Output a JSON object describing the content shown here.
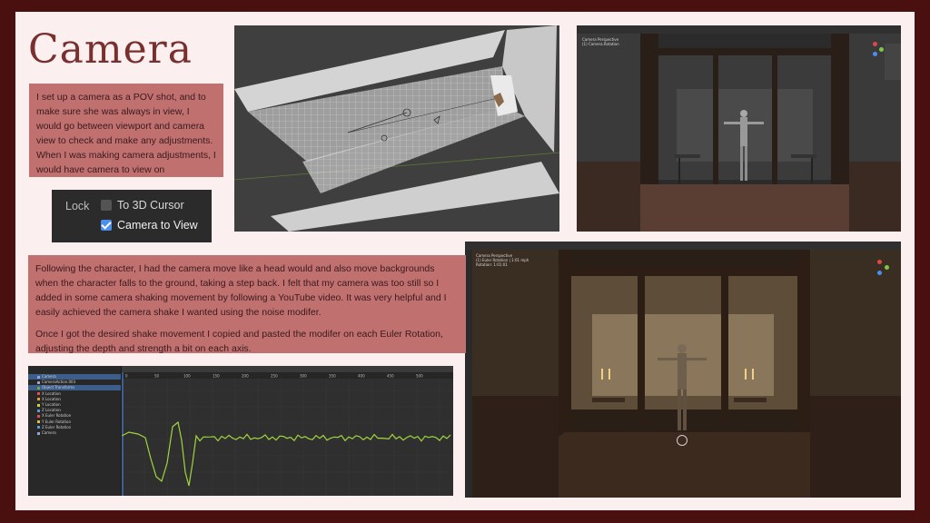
{
  "title": "Camera",
  "paragraph_1": "I set up a camera as a POV shot, and to make sure she was always in view, I would go between viewport and camera view to check and make any adjustments. When I was making camera adjustments, I would have camera to view on",
  "lock_panel": {
    "label": "Lock",
    "options": [
      {
        "label": "To 3D Cursor",
        "checked": false
      },
      {
        "label": "Camera to View",
        "checked": true
      }
    ]
  },
  "paragraph_2a": "Following the character, I had the camera move like a head would and also move backgrounds when the character falls to the ground, taking a step back. I felt that my camera was too still so I added in some camera shaking movement by following a YouTube video. It was very helpful and I easily achieved the camera shake I wanted using the noise modifer.",
  "paragraph_2b": "Once I got the desired shake movement I copied and pasted the modifer on each Euler Rotation, adjusting the depth and strength a bit on each axis.",
  "screenshots": {
    "viewport_top": {
      "name": "Top-down viewport of room with camera"
    },
    "camera_view_1": {
      "name": "Camera view of room with figure",
      "overlay": [
        "Camera Perspective",
        "(1) Camera.Rotation"
      ]
    },
    "camera_view_2": {
      "name": "Rendered camera view of room",
      "overlay": [
        "Camera Perspective",
        "(1) Euler Rotation | 1:01 mph",
        "Rotation: 1:01:01"
      ]
    },
    "graph_editor": {
      "name": "Graph editor with noise modifier curves",
      "ruler_ticks": [
        "0",
        "50",
        "100",
        "150",
        "200",
        "250",
        "300",
        "350",
        "400",
        "450",
        "500"
      ],
      "outliner": [
        {
          "label": "Camera",
          "color": "#8fa8d8",
          "selected": true
        },
        {
          "label": "CameraAction.003",
          "color": "#8fa8d8",
          "selected": false
        },
        {
          "label": "Object Transforms",
          "color": "#6aa84f",
          "selected": true
        },
        {
          "label": "X Location",
          "color": "#e05050",
          "selected": false
        },
        {
          "label": "X Location",
          "color": "#e0a030",
          "selected": false
        },
        {
          "label": "Y Location",
          "color": "#d0d040",
          "selected": false
        },
        {
          "label": "Z Location",
          "color": "#50a0e0",
          "selected": false
        },
        {
          "label": "X Euler Rotation",
          "color": "#e05050",
          "selected": false
        },
        {
          "label": "Y Euler Rotation",
          "color": "#e0c030",
          "selected": false
        },
        {
          "label": "Z Euler Rotation",
          "color": "#50a0e0",
          "selected": false
        },
        {
          "label": "Camera",
          "color": "#8fa8d8",
          "selected": false
        }
      ]
    }
  },
  "colors": {
    "frame": "#4a0f0f",
    "page": "#fbf0ef",
    "title": "#7a2f2f",
    "textbox": "#c0706f",
    "curve": "#9fd63c"
  }
}
